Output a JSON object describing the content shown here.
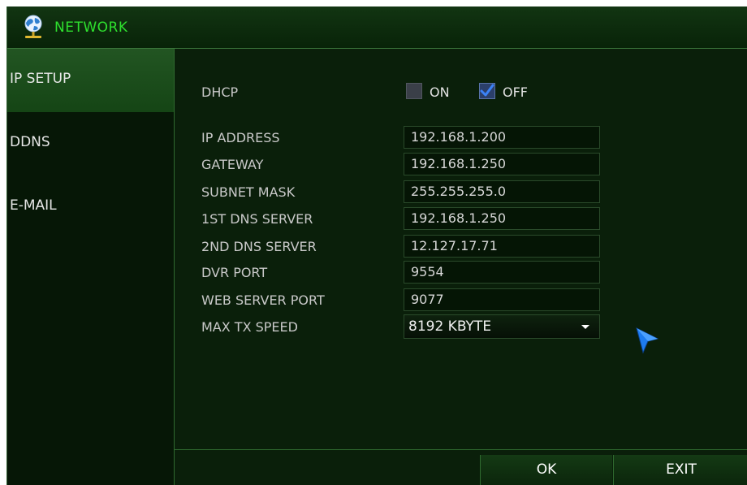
{
  "window": {
    "title": "NETWORK",
    "title_icon": "globe-network-icon"
  },
  "sidebar": {
    "items": [
      {
        "label": "IP SETUP",
        "active": true
      },
      {
        "label": "DDNS",
        "active": false
      },
      {
        "label": "E-MAIL",
        "active": false
      }
    ]
  },
  "dhcp": {
    "label": "DHCP",
    "on_label": "ON",
    "on_checked": false,
    "off_label": "OFF",
    "off_checked": true
  },
  "fields": {
    "ip_address": {
      "label": "IP ADDRESS",
      "value": "192.168.1.200"
    },
    "gateway": {
      "label": "GATEWAY",
      "value": "192.168.1.250"
    },
    "subnet_mask": {
      "label": "SUBNET MASK",
      "value": "255.255.255.0"
    },
    "dns1": {
      "label": "1ST DNS SERVER",
      "value": "192.168.1.250"
    },
    "dns2": {
      "label": "2ND DNS SERVER",
      "value": "12.127.17.71"
    },
    "dvr_port": {
      "label": "DVR PORT",
      "value": "9554"
    },
    "web_port": {
      "label": "WEB SERVER PORT",
      "value": "9077"
    }
  },
  "max_tx_speed": {
    "label": "MAX TX SPEED",
    "value": "8192 KBYTE"
  },
  "buttons": {
    "ok": "OK",
    "exit": "EXIT"
  },
  "colors": {
    "title_green": "#2ee02e",
    "background": "#0a1f0a",
    "checkbox_blue": "#3b82f6"
  }
}
